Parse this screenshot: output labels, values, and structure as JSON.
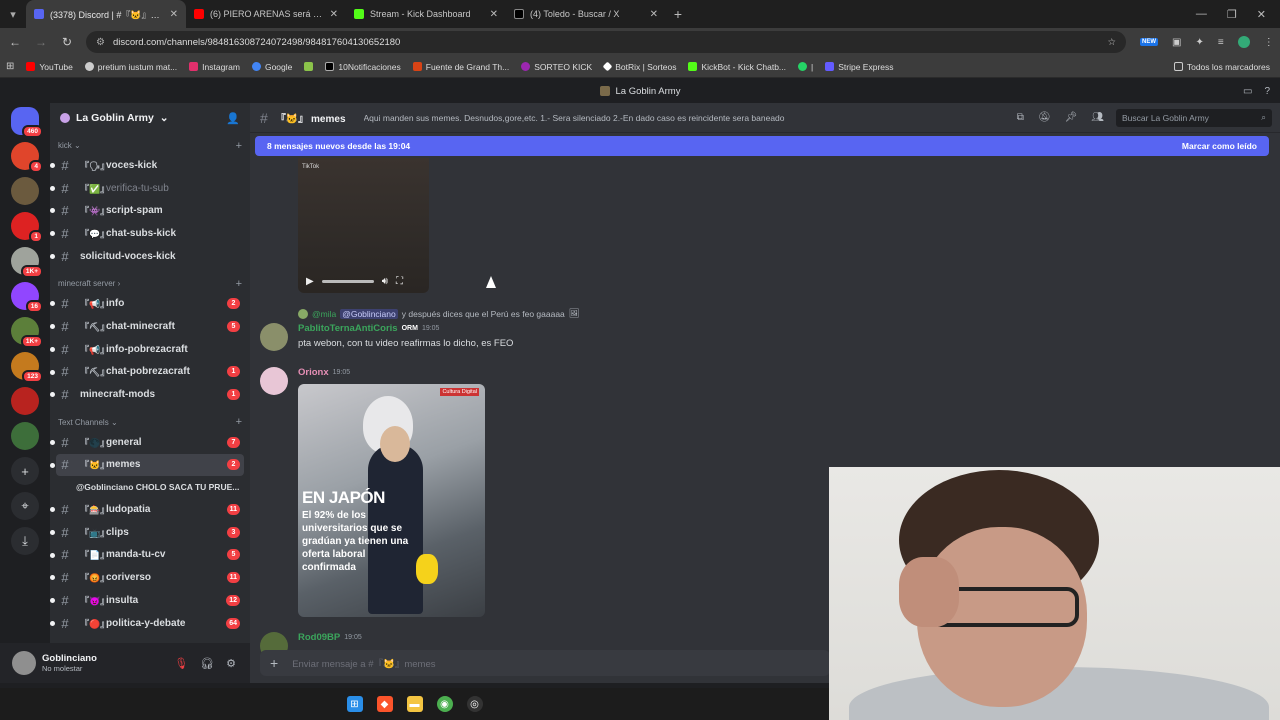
{
  "browser": {
    "tabs": [
      {
        "title": "(3378) Discord | #『🐱』memes | La Goblin Army",
        "color": "#5865f2",
        "active": true
      },
      {
        "title": "(6) PIERO ARENAS será ¿DE",
        "color": "#ff0000",
        "active": false
      },
      {
        "title": "Stream - Kick Dashboard",
        "color": "#53fc18",
        "active": false
      },
      {
        "title": "(4) Toledo - Buscar / X",
        "color": "#ffffff",
        "active": false
      }
    ],
    "url": "discord.com/channels/984816308724072498/984817604130652180",
    "bookmarks": [
      {
        "label": "YouTube",
        "color": "#ff0000"
      },
      {
        "label": "pretium iustum mat...",
        "color": "#cccccc"
      },
      {
        "label": "Instagram",
        "color": "#e1306c"
      },
      {
        "label": "Google",
        "color": "#4285f4"
      },
      {
        "label": "",
        "color": "#8bc34a"
      },
      {
        "label": "10Notificaciones",
        "color": "#ffffff"
      },
      {
        "label": "Fuente de Grand Th...",
        "color": "#d84315"
      },
      {
        "label": "SORTEO KICK",
        "color": "#9c27b0"
      },
      {
        "label": "BotRix | Sorteos",
        "color": "#ffffff"
      },
      {
        "label": "KickBot - Kick Chatb...",
        "color": "#53fc18"
      },
      {
        "label": "|",
        "color": "#25d366"
      },
      {
        "label": "Stripe Express",
        "color": "#635bff"
      }
    ],
    "bookmarks_right": "Todos los marcadores",
    "new_badge": "NEW"
  },
  "discord": {
    "window_title": "La Goblin Army",
    "servers": [
      {
        "color": "#5865f2",
        "badge": "460",
        "label": "discord-home"
      },
      {
        "color": "#e0452b",
        "badge": "4"
      },
      {
        "color": "#6b5a3e",
        "badge": ""
      },
      {
        "color": "#d22",
        "badge": "1"
      },
      {
        "color": "#9fa39c",
        "badge": "1K+"
      },
      {
        "color": "#9146ff",
        "badge": "16"
      },
      {
        "color": "#5c7f3a",
        "badge": "1K+"
      },
      {
        "color": "#c47a1e",
        "badge": "123"
      },
      {
        "color": "#b8231f",
        "badge": ""
      },
      {
        "color": "#3d6e3a",
        "badge": ""
      }
    ],
    "guild_name": "La Goblin Army",
    "categories": {
      "kick": "kick",
      "minecraft": "minecraft server",
      "text": "Text Channels"
    },
    "kick_channels": [
      {
        "emoji": "『🗣』",
        "name": "voces-kick",
        "count": "",
        "muted": false
      },
      {
        "emoji": "『✅』",
        "name": "verifica-tu-sub",
        "count": "",
        "muted": true
      },
      {
        "emoji": "『👾』",
        "name": "script-spam",
        "count": "",
        "muted": false
      },
      {
        "emoji": "『💬』",
        "name": "chat-subs-kick",
        "count": "",
        "muted": false
      },
      {
        "emoji": "",
        "name": "solicitud-voces-kick",
        "count": "",
        "muted": false
      }
    ],
    "mc_channels": [
      {
        "emoji": "『📢』",
        "name": "info",
        "count": "2"
      },
      {
        "emoji": "『⛏』",
        "name": "chat-minecraft",
        "count": "5"
      },
      {
        "emoji": "『📢』",
        "name": "info-pobrezacraft",
        "count": ""
      },
      {
        "emoji": "『⛏』",
        "name": "chat-pobrezacraft",
        "count": "1"
      },
      {
        "emoji": "",
        "name": "minecraft-mods",
        "count": "1"
      }
    ],
    "text_channels": [
      {
        "emoji": "『🌑』",
        "name": "general",
        "count": "7",
        "active": false
      },
      {
        "emoji": "『🐱』",
        "name": "memes",
        "count": "2",
        "active": true
      },
      {
        "emoji": "『🎰』",
        "name": "ludopatia",
        "count": "11",
        "active": false
      },
      {
        "emoji": "『📺』",
        "name": "clips",
        "count": "3",
        "active": false
      },
      {
        "emoji": "『📄』",
        "name": "manda-tu-cv",
        "count": "5",
        "active": false
      },
      {
        "emoji": "『😡』",
        "name": "coriverso",
        "count": "11",
        "active": false
      },
      {
        "emoji": "『😈』",
        "name": "insulta",
        "count": "12",
        "active": false
      },
      {
        "emoji": "『🔴』",
        "name": "politica-y-debate",
        "count": "64",
        "active": false
      }
    ],
    "thread": "@Goblinciano CHOLO SACA TU PRUE...",
    "user": {
      "name": "Goblinciano",
      "status": "No molestar"
    },
    "channel": {
      "emoji": "『🐱』",
      "name": "memes",
      "topic": "Aqui manden sus memes. Desnudos,gore,etc. 1.- Sera silenciado 2.-En dado caso es reincidente sera baneado",
      "search_placeholder": "Buscar La Goblin Army"
    },
    "new_messages": {
      "text": "8 mensajes nuevos desde las 19:04",
      "action": "Marcar como leído"
    },
    "video": {
      "watermark": "TikTok"
    },
    "reply": {
      "author": "@mila",
      "mention": "@Goblinciano",
      "text": "y después dices que el Perú es feo gaaaaa"
    },
    "messages": [
      {
        "author": "PablitoTernaAntiCoris",
        "color": "#3ba55c",
        "tag": "ORM",
        "time": "19:05",
        "text": "pta webon, con tu video reafirmas lo dicho, es FEO"
      },
      {
        "author": "Orionx",
        "color": "#e68fb6",
        "tag": "",
        "time": "19:05",
        "text": ""
      },
      {
        "author": "Rod09BP",
        "color": "#3ba55c",
        "tag": "",
        "time": "19:05",
        "text": ""
      }
    ],
    "meme": {
      "source": "Cultura Digital",
      "headline": "EN JAPÓN",
      "body": "El 92% de los universitarios que se gradúan ya tienen una oferta laboral confirmada"
    },
    "composer_placeholder": "Enviar mensaje a #『🐱』memes"
  }
}
